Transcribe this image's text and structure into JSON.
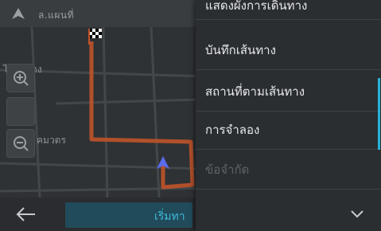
{
  "topbar": {
    "title": "ล.แผนที่",
    "nav_icon": "navigation-arrow-icon"
  },
  "map": {
    "zoom_in_icon": "zoom-in-icon",
    "zoom_out_icon": "zoom-out-icon",
    "labels": [
      "ไอวันทาง",
      "คมวตร"
    ],
    "route_color": "#c0532a",
    "destination_icon": "checkered-flag-icon",
    "position_icon": "vehicle-position-icon"
  },
  "bottombar": {
    "back_icon": "back-arrow-icon",
    "start_label": "เริ่มทา"
  },
  "menu": {
    "items": [
      {
        "label": "แสดงผังการเดินทาง",
        "enabled": true
      },
      {
        "label": "บันทึกเส้นทาง",
        "enabled": true
      },
      {
        "label": "สถานที่ตามเส้นทาง",
        "enabled": true
      },
      {
        "label": "การจำลอง",
        "enabled": true
      },
      {
        "label": "ข้อจำกัด",
        "enabled": false
      }
    ],
    "chevron_icon": "chevron-down-icon",
    "accent_color": "#27b3d6"
  }
}
